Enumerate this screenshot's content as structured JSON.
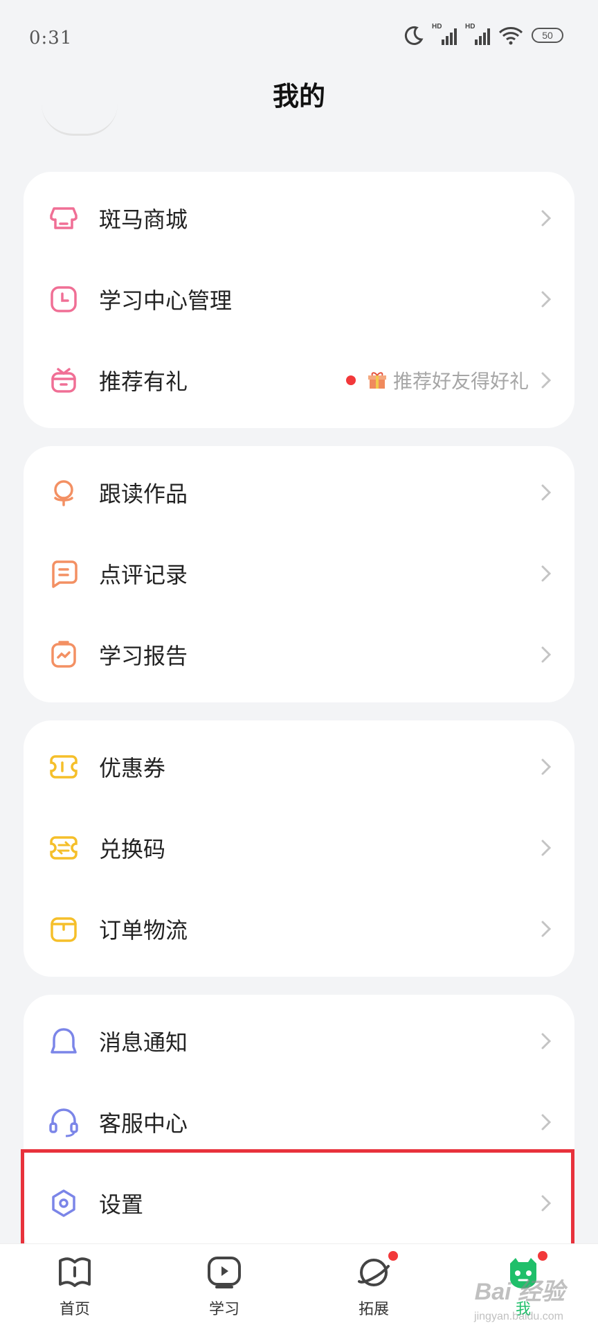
{
  "status_bar": {
    "time": "0:31",
    "battery": "50",
    "hd1": "HD",
    "hd2": "HD"
  },
  "header": {
    "title": "我的"
  },
  "groups": [
    {
      "items": [
        {
          "label": "斑马商城",
          "icon": "store-icon",
          "color": "#f06f95"
        },
        {
          "label": "学习中心管理",
          "icon": "clock-icon",
          "color": "#f06f95"
        },
        {
          "label": "推荐有礼",
          "icon": "gift-box-icon",
          "color": "#f06f95",
          "extra": "推荐好友得好礼"
        }
      ]
    },
    {
      "items": [
        {
          "label": "跟读作品",
          "icon": "microphone-icon",
          "color": "#f39063"
        },
        {
          "label": "点评记录",
          "icon": "comment-icon",
          "color": "#f39063"
        },
        {
          "label": "学习报告",
          "icon": "report-icon",
          "color": "#f39063"
        }
      ]
    },
    {
      "items": [
        {
          "label": "优惠券",
          "icon": "coupon-icon",
          "color": "#f5bf2a"
        },
        {
          "label": "兑换码",
          "icon": "exchange-icon",
          "color": "#f5bf2a"
        },
        {
          "label": "订单物流",
          "icon": "package-icon",
          "color": "#f5bf2a"
        }
      ]
    },
    {
      "items": [
        {
          "label": "消息通知",
          "icon": "bell-icon",
          "color": "#7b85e8"
        },
        {
          "label": "客服中心",
          "icon": "headset-icon",
          "color": "#7b85e8"
        },
        {
          "label": "设置",
          "icon": "settings-icon",
          "color": "#7b85e8"
        }
      ]
    }
  ],
  "tabbar": {
    "tabs": [
      {
        "label": "首页",
        "icon": "home-book-icon"
      },
      {
        "label": "学习",
        "icon": "play-tv-icon"
      },
      {
        "label": "拓展",
        "icon": "planet-icon"
      },
      {
        "label": "我",
        "icon": "zebra-face-icon"
      }
    ]
  },
  "watermark": {
    "text": "Bai 经验",
    "sub": "jingyan.baidu.com"
  }
}
